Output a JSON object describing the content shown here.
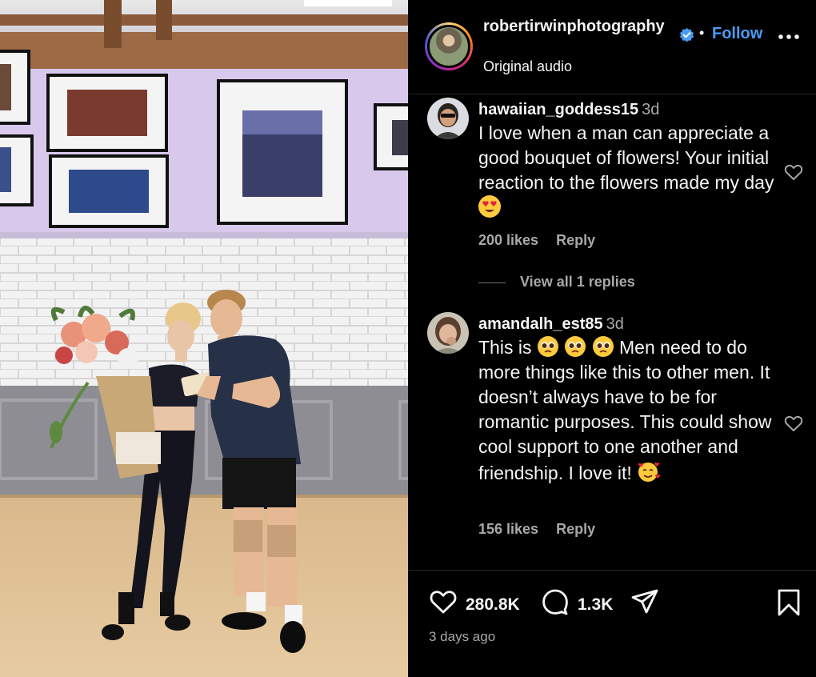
{
  "post": {
    "username": "robertirwinphotography",
    "follow_label": "Follow",
    "separator": "•",
    "audio": "Original audio",
    "verified_color": "#4a9cf5"
  },
  "comments": [
    {
      "username": "hawaiian_goddess15",
      "time": "3d",
      "text": "I love when a man can appreciate a good bouquet of flowers! Your initial reaction to the flowers made my day",
      "emoji": [
        "heart-eyes-emoji"
      ],
      "likes": "200 likes",
      "reply_label": "Reply"
    },
    {
      "username": "amandalh_est85",
      "time": "3d",
      "text_before": "This is",
      "emoji": [
        "pleading-face-emoji",
        "pleading-face-emoji",
        "pleading-face-emoji",
        "smiling-face-with-hearts-emoji"
      ],
      "text_after": "Men need to do more things like this to other men. It doesn’t always have to be for romantic purposes. This could show cool support to one another and friendship. I love it!",
      "likes": "156 likes",
      "reply_label": "Reply"
    }
  ],
  "view_replies": "View all 1 replies",
  "actions": {
    "like_count": "280.8K",
    "comment_count": "1.3K",
    "icons": [
      "heart-icon",
      "comment-icon",
      "share-icon",
      "bookmark-icon"
    ]
  },
  "post_time": "3 days ago",
  "colors": {
    "background": "#000000",
    "text": "#f5f5f5",
    "muted": "#a8a8a8",
    "accent": "#4a9cf5",
    "wall": "#d8c9ec"
  }
}
